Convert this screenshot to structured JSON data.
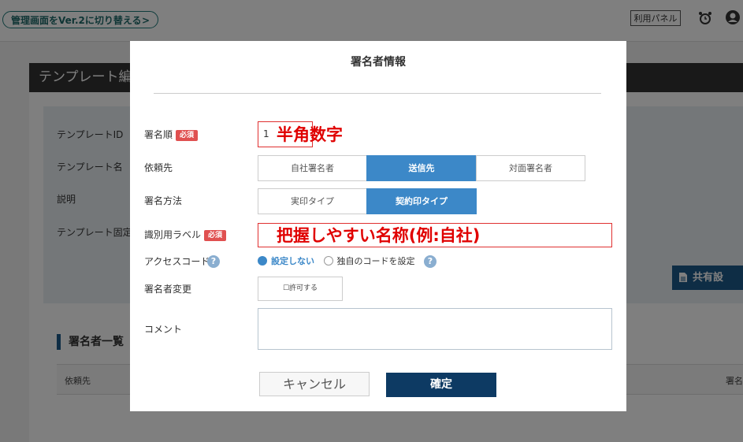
{
  "background": {
    "version_button": "管理画面をVer.2に切り替える",
    "panel_button": "利用パネル",
    "template_header": "テンプレート編",
    "fields": [
      "テンプレートID",
      "テンプレート名",
      "説明",
      "テンプレート固定"
    ],
    "share_button": "共有設",
    "signer_section_title": "署名者一覧",
    "signer_table": {
      "col_request": "依頼先",
      "col_signer": "署名"
    }
  },
  "modal": {
    "title": "署名者情報",
    "required_badge": "必須",
    "order": {
      "label": "署名順",
      "value": "1",
      "annotation": "半角数字"
    },
    "request_to": {
      "label": "依頼先",
      "options": [
        "自社署名者",
        "送信先",
        "対面署名者"
      ],
      "selected": "送信先"
    },
    "sign_method": {
      "label": "署名方法",
      "options": [
        "実印タイプ",
        "契約印タイプ"
      ],
      "selected": "契約印タイプ"
    },
    "id_label": {
      "label": "識別用ラベル",
      "annotation": "把握しやすい名称(例:自社)"
    },
    "access_code": {
      "label": "アクセスコード",
      "help": "?",
      "options": [
        "設定しない",
        "独自のコードを設定"
      ],
      "selected": "設定しない"
    },
    "signer_change": {
      "label": "署名者変更",
      "checkbox_label": "☐許可する"
    },
    "comment": {
      "label": "コメント",
      "value": ""
    },
    "cancel_label": "キャンセル",
    "confirm_label": "確定"
  }
}
